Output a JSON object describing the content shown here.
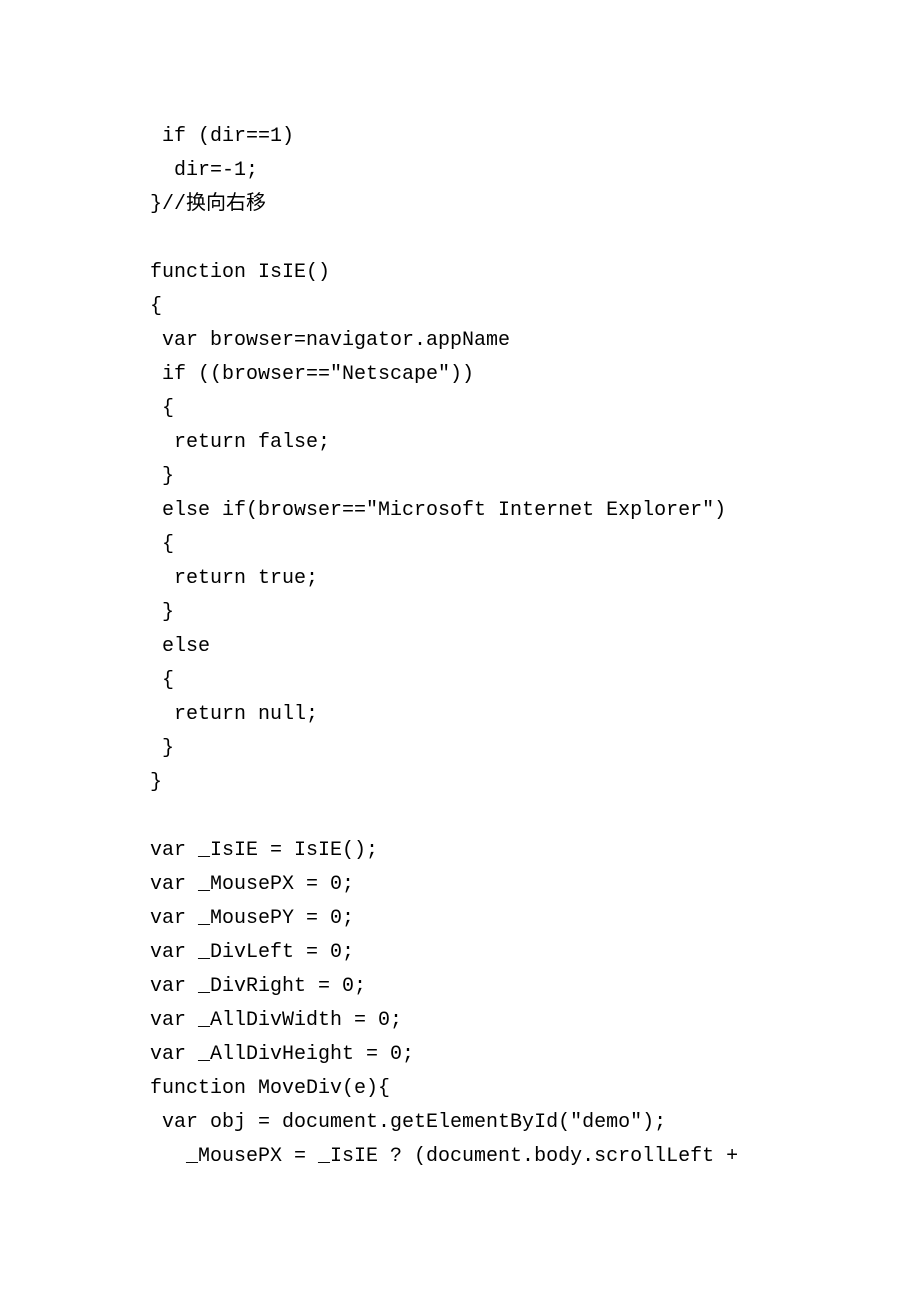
{
  "code_lines": [
    " if (dir==1)",
    "  dir=-1;",
    "}//换向右移",
    "",
    "function IsIE()",
    "{",
    " var browser=navigator.appName",
    " if ((browser==\"Netscape\"))",
    " {",
    "  return false;",
    " }",
    " else if(browser==\"Microsoft Internet Explorer\")",
    " {",
    "  return true;",
    " }",
    " else",
    " {",
    "  return null;",
    " }",
    "}",
    "",
    "var _IsIE = IsIE();",
    "var _MousePX = 0;",
    "var _MousePY = 0;",
    "var _DivLeft = 0;",
    "var _DivRight = 0;",
    "var _AllDivWidth = 0;",
    "var _AllDivHeight = 0;",
    "function MoveDiv(e){",
    " var obj = document.getElementById(\"demo\");",
    "   _MousePX = _IsIE ? (document.body.scrollLeft +"
  ]
}
